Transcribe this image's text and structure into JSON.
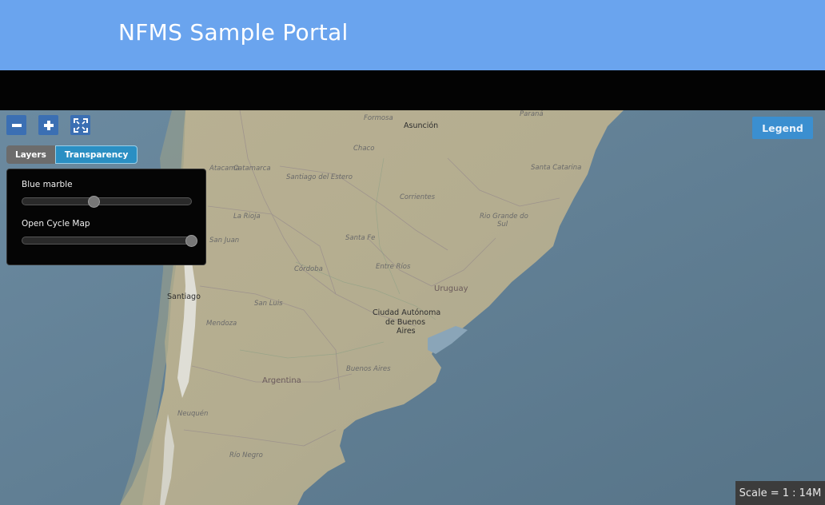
{
  "header": {
    "title": "NFMS Sample Portal"
  },
  "map_controls": {
    "zoom_out_icon": "minus-icon",
    "zoom_in_icon": "plus-icon",
    "fullscreen_icon": "fullscreen-icon"
  },
  "tabs": {
    "layers": "Layers",
    "transparency": "Transparency"
  },
  "transparency": {
    "layers": [
      {
        "label": "Blue marble",
        "value_fraction": 0.42
      },
      {
        "label": "Open Cycle Map",
        "value_fraction": 1.0
      }
    ]
  },
  "legend": {
    "label": "Legend"
  },
  "scale": {
    "text": "Scale = 1 : 14M"
  },
  "places": {
    "formosa": "Formosa",
    "asuncion": "Asunción",
    "parana": "Paraná",
    "chaco": "Chaco",
    "santa_catarina": "Santa Catarina",
    "catamarca": "Catamarca",
    "santiago_del_estero": "Santiago del Estero",
    "atacama": "Atacama",
    "de_atacama": "de Atacama",
    "corrientes": "Corrientes",
    "la_rioja": "La Rioja",
    "rio_grande_do_sul_1": "Rio Grande do",
    "rio_grande_do_sul_2": "Sul",
    "san_juan": "San Juan",
    "santa_fe": "Santa Fe",
    "entre_rios": "Entre Ríos",
    "cordoba": "Córdoba",
    "uruguay": "Uruguay",
    "santiago": "Santiago",
    "san_luis": "San Luis",
    "caba_1": "Ciudad Autónoma",
    "caba_2": "de Buenos",
    "caba_3": "Aires",
    "mendoza": "Mendoza",
    "buenos_aires": "Buenos Aires",
    "argentina": "Argentina",
    "neuquen": "Neuquén",
    "rio_negro": "Río Negro"
  }
}
